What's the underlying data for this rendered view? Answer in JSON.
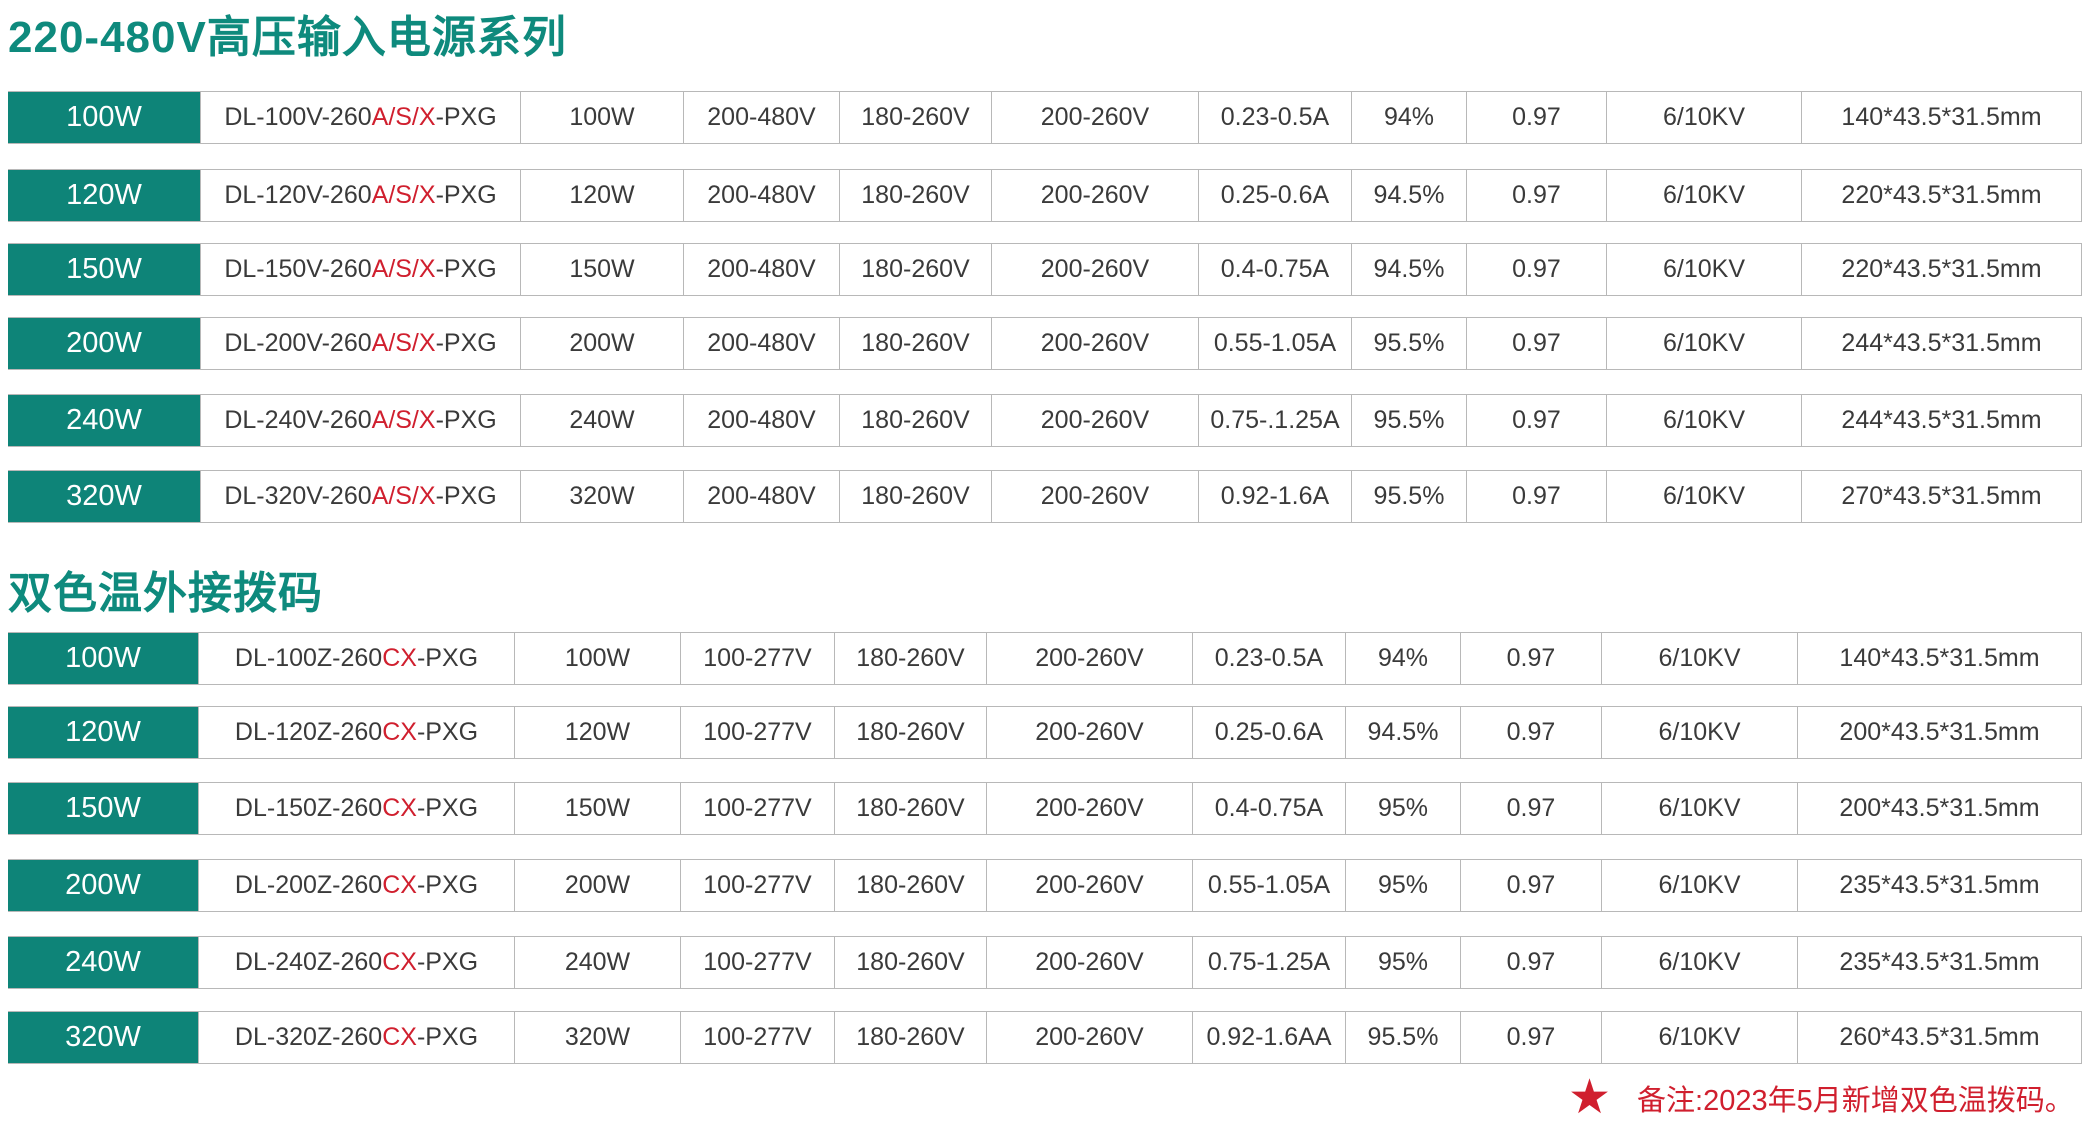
{
  "section1": {
    "title": "220-480V高压输入电源系列",
    "rows": [
      {
        "power": "100W",
        "model_prefix": "DL-100V-260",
        "model_suffix": "A/S/X",
        "model_end": "-PXG",
        "wattage": "100W",
        "input": "200-480V",
        "v1": "180-260V",
        "v2": "200-260V",
        "current": "0.23-0.5A",
        "efficiency": "94%",
        "pf": "0.97",
        "surge": "6/10KV",
        "size": "140*43.5*31.5mm"
      },
      {
        "power": "120W",
        "model_prefix": "DL-120V-260",
        "model_suffix": "A/S/X",
        "model_end": "-PXG",
        "wattage": "120W",
        "input": "200-480V",
        "v1": "180-260V",
        "v2": "200-260V",
        "current": "0.25-0.6A",
        "efficiency": "94.5%",
        "pf": "0.97",
        "surge": "6/10KV",
        "size": "220*43.5*31.5mm"
      },
      {
        "power": "150W",
        "model_prefix": "DL-150V-260",
        "model_suffix": "A/S/X",
        "model_end": "-PXG",
        "wattage": "150W",
        "input": "200-480V",
        "v1": "180-260V",
        "v2": "200-260V",
        "current": "0.4-0.75A",
        "efficiency": "94.5%",
        "pf": "0.97",
        "surge": "6/10KV",
        "size": "220*43.5*31.5mm"
      },
      {
        "power": "200W",
        "model_prefix": "DL-200V-260",
        "model_suffix": "A/S/X",
        "model_end": "-PXG",
        "wattage": "200W",
        "input": "200-480V",
        "v1": "180-260V",
        "v2": "200-260V",
        "current": "0.55-1.05A",
        "efficiency": "95.5%",
        "pf": "0.97",
        "surge": "6/10KV",
        "size": "244*43.5*31.5mm"
      },
      {
        "power": "240W",
        "model_prefix": "DL-240V-260",
        "model_suffix": "A/S/X",
        "model_end": "-PXG",
        "wattage": "240W",
        "input": "200-480V",
        "v1": "180-260V",
        "v2": "200-260V",
        "current": "0.75-.1.25A",
        "efficiency": "95.5%",
        "pf": "0.97",
        "surge": "6/10KV",
        "size": "244*43.5*31.5mm"
      },
      {
        "power": "320W",
        "model_prefix": "DL-320V-260",
        "model_suffix": "A/S/X",
        "model_end": "-PXG",
        "wattage": "320W",
        "input": "200-480V",
        "v1": "180-260V",
        "v2": "200-260V",
        "current": "0.92-1.6A",
        "efficiency": "95.5%",
        "pf": "0.97",
        "surge": "6/10KV",
        "size": "270*43.5*31.5mm"
      }
    ]
  },
  "section2": {
    "title": "双色温外接拨码",
    "rows": [
      {
        "power": "100W",
        "model_prefix": "DL-100Z-260",
        "model_suffix": "CX",
        "model_end": "-PXG",
        "wattage": "100W",
        "input": "100-277V",
        "v1": "180-260V",
        "v2": "200-260V",
        "current": "0.23-0.5A",
        "efficiency": "94%",
        "pf": "0.97",
        "surge": "6/10KV",
        "size": "140*43.5*31.5mm"
      },
      {
        "power": "120W",
        "model_prefix": "DL-120Z-260",
        "model_suffix": "CX",
        "model_end": "-PXG",
        "wattage": "120W",
        "input": "100-277V",
        "v1": "180-260V",
        "v2": "200-260V",
        "current": "0.25-0.6A",
        "efficiency": "94.5%",
        "pf": "0.97",
        "surge": "6/10KV",
        "size": "200*43.5*31.5mm"
      },
      {
        "power": "150W",
        "model_prefix": "DL-150Z-260",
        "model_suffix": "CX",
        "model_end": "-PXG",
        "wattage": "150W",
        "input": "100-277V",
        "v1": "180-260V",
        "v2": "200-260V",
        "current": "0.4-0.75A",
        "efficiency": "95%",
        "pf": "0.97",
        "surge": "6/10KV",
        "size": "200*43.5*31.5mm"
      },
      {
        "power": "200W",
        "model_prefix": "DL-200Z-260",
        "model_suffix": "CX",
        "model_end": "-PXG",
        "wattage": "200W",
        "input": "100-277V",
        "v1": "180-260V",
        "v2": "200-260V",
        "current": "0.55-1.05A",
        "efficiency": "95%",
        "pf": "0.97",
        "surge": "6/10KV",
        "size": "235*43.5*31.5mm"
      },
      {
        "power": "240W",
        "model_prefix": "DL-240Z-260",
        "model_suffix": "CX",
        "model_end": "-PXG",
        "wattage": "240W",
        "input": "100-277V",
        "v1": "180-260V",
        "v2": "200-260V",
        "current": "0.75-1.25A",
        "efficiency": "95%",
        "pf": "0.97",
        "surge": "6/10KV",
        "size": "235*43.5*31.5mm"
      },
      {
        "power": "320W",
        "model_prefix": "DL-320Z-260",
        "model_suffix": "CX",
        "model_end": "-PXG",
        "wattage": "320W",
        "input": "100-277V",
        "v1": "180-260V",
        "v2": "200-260V",
        "current": "0.92-1.6AA",
        "efficiency": "95.5%",
        "pf": "0.97",
        "surge": "6/10KV",
        "size": "260*43.5*31.5mm"
      }
    ]
  },
  "note": {
    "icon": "star-icon",
    "text": "备注:2023年5月新增双色温拨码。"
  },
  "colors": {
    "accent": "#0e8478",
    "highlight": "#d01f2e"
  }
}
